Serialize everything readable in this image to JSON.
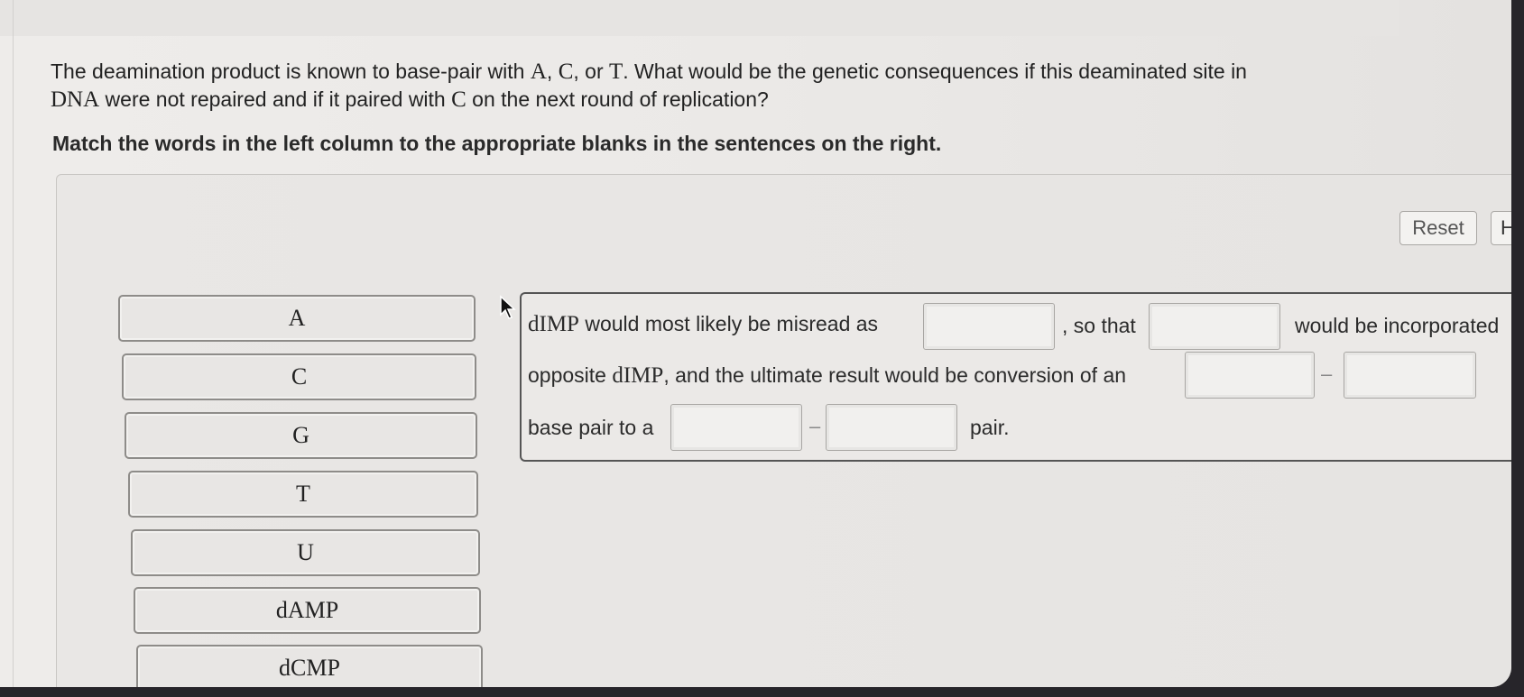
{
  "question": {
    "part1": "The deamination product is known to base-pair with ",
    "A": "A",
    "sep1": ", ",
    "C": "C",
    "sep2": ", or ",
    "T": "T",
    "part2": ". What would be the genetic consequences if this deaminated site in ",
    "DNA": "DNA",
    "part3": " were not repaired and if it paired with ",
    "C2": "C",
    "part4": " on the next round of replication?"
  },
  "instruction": "Match the words in the left column to the appropriate blanks in the sentences on the right.",
  "toolbar": {
    "reset_label": "Reset",
    "help_label": "H"
  },
  "word_bank": [
    "A",
    "C",
    "G",
    "T",
    "U",
    "dAMP",
    "dCMP"
  ],
  "sentence": {
    "dimp": "dIMP",
    "l1_a": " would most likely be misread as",
    "l1_b": ", so that",
    "l1_c": "would be incorporated",
    "l2_a": "opposite ",
    "l2_b": ", and the ultimate result would be conversion of an",
    "l3_a": "base pair to a",
    "l3_b": "pair.",
    "dash": "–"
  }
}
